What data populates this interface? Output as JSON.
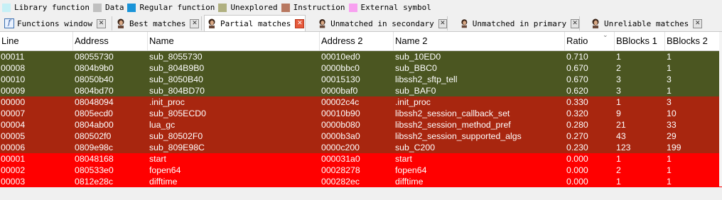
{
  "legend": [
    {
      "label": "Library function",
      "color": "#c6f0f6"
    },
    {
      "label": "Data",
      "color": "#c0c0c0"
    },
    {
      "label": "Regular function",
      "color": "#1a94d8"
    },
    {
      "label": "Unexplored",
      "color": "#b0b080"
    },
    {
      "label": "Instruction",
      "color": "#b87860"
    },
    {
      "label": "External symbol",
      "color": "#f8a0f0"
    }
  ],
  "tabs": [
    {
      "label": "Functions window",
      "icon": "function-icon"
    },
    {
      "label": "Best matches",
      "icon": "ida-avatar-icon"
    },
    {
      "label": "Partial matches",
      "icon": "ida-avatar-icon",
      "active": true
    },
    {
      "label": "Unmatched in secondary",
      "icon": "ida-avatar-icon"
    },
    {
      "label": "Unmatched in primary",
      "icon": "ida-avatar-icon"
    },
    {
      "label": "Unreliable matches",
      "icon": "ida-avatar-icon"
    }
  ],
  "columns": [
    "Line",
    "Address",
    "Name",
    "Address 2",
    "Name 2",
    "Ratio",
    "BBlocks 1",
    "BBlocks 2"
  ],
  "row_colors": {
    "olive": "#4b5621",
    "brick": "#a8260f",
    "red": "#ff0000"
  },
  "rows": [
    {
      "line": "00011",
      "address": "08055730",
      "name": "sub_8055730",
      "address2": "00010ed0",
      "name2": "sub_10ED0",
      "ratio": "0.710",
      "bb1": "1",
      "bb2": "1",
      "color": "olive"
    },
    {
      "line": "00008",
      "address": "0804b9b0",
      "name": "sub_804B9B0",
      "address2": "0000bbc0",
      "name2": "sub_BBC0",
      "ratio": "0.670",
      "bb1": "2",
      "bb2": "1",
      "color": "olive"
    },
    {
      "line": "00010",
      "address": "08050b40",
      "name": "sub_8050B40",
      "address2": "00015130",
      "name2": "libssh2_sftp_tell",
      "ratio": "0.670",
      "bb1": "3",
      "bb2": "3",
      "color": "olive"
    },
    {
      "line": "00009",
      "address": "0804bd70",
      "name": "sub_804BD70",
      "address2": "0000baf0",
      "name2": "sub_BAF0",
      "ratio": "0.620",
      "bb1": "3",
      "bb2": "1",
      "color": "olive"
    },
    {
      "line": "00000",
      "address": "08048094",
      "name": ".init_proc",
      "address2": "00002c4c",
      "name2": ".init_proc",
      "ratio": "0.330",
      "bb1": "1",
      "bb2": "3",
      "color": "brick"
    },
    {
      "line": "00007",
      "address": "0805ecd0",
      "name": "sub_805ECD0",
      "address2": "00010b90",
      "name2": "libssh2_session_callback_set",
      "ratio": "0.320",
      "bb1": "9",
      "bb2": "10",
      "color": "brick"
    },
    {
      "line": "00004",
      "address": "0804ab00",
      "name": "lua_gc",
      "address2": "0000b080",
      "name2": "libssh2_session_method_pref",
      "ratio": "0.280",
      "bb1": "21",
      "bb2": "33",
      "color": "brick"
    },
    {
      "line": "00005",
      "address": "080502f0",
      "name": "sub_80502F0",
      "address2": "0000b3a0",
      "name2": "libssh2_session_supported_algs",
      "ratio": "0.270",
      "bb1": "43",
      "bb2": "29",
      "color": "brick"
    },
    {
      "line": "00006",
      "address": "0809e98c",
      "name": "sub_809E98C",
      "address2": "0000c200",
      "name2": "sub_C200",
      "ratio": "0.230",
      "bb1": "123",
      "bb2": "199",
      "color": "brick"
    },
    {
      "line": "00001",
      "address": "08048168",
      "name": "start",
      "address2": "000031a0",
      "name2": "start",
      "ratio": "0.000",
      "bb1": "1",
      "bb2": "1",
      "color": "red"
    },
    {
      "line": "00002",
      "address": "080533e0",
      "name": "fopen64",
      "address2": "00028278",
      "name2": "fopen64",
      "ratio": "0.000",
      "bb1": "2",
      "bb2": "1",
      "color": "red"
    },
    {
      "line": "00003",
      "address": "0812e28c",
      "name": "difftime",
      "address2": "000282ec",
      "name2": "difftime",
      "ratio": "0.000",
      "bb1": "1",
      "bb2": "1",
      "color": "red"
    }
  ]
}
